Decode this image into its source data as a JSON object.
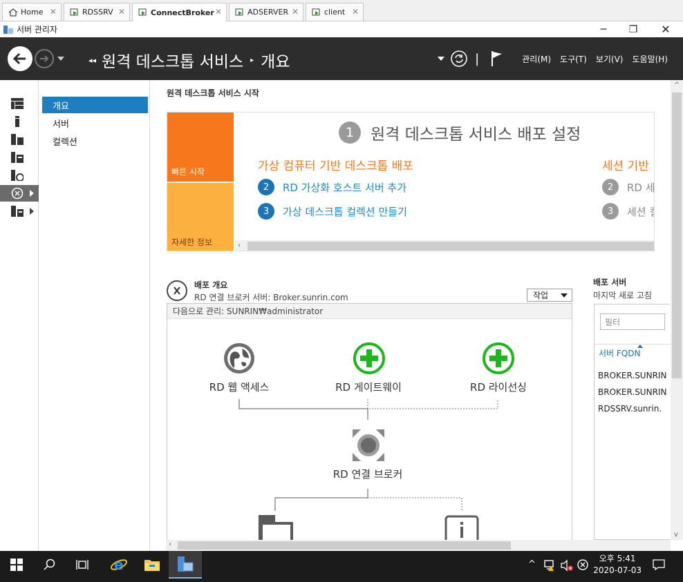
{
  "tabs": [
    {
      "label": "Home",
      "icon": "home-icon"
    },
    {
      "label": "RDSSRV",
      "icon": "vm-icon"
    },
    {
      "label": "ConnectBroker",
      "icon": "vm-icon",
      "active": true
    },
    {
      "label": "ADSERVER",
      "icon": "vm-icon"
    },
    {
      "label": "client",
      "icon": "vm-icon"
    }
  ],
  "window": {
    "title": "서버 관리자"
  },
  "header": {
    "breadcrumb_root": "원격 데스크톱 서비스",
    "breadcrumb_page": "개요",
    "menus": [
      "관리(M)",
      "도구(T)",
      "보기(V)",
      "도움말(H)"
    ]
  },
  "subnav": [
    "개요",
    "서버",
    "컬렉션"
  ],
  "main": {
    "section_title": "원격 데스크톱 서비스 시작",
    "quickstart": {
      "tile_quick": "빠른 시작",
      "tile_more": "자세한 정보",
      "step1_num": "1",
      "step1_label": "원격 데스크톱 서비스 배포 설정",
      "left_heading": "가상 컴퓨터 기반 데스크톱 배포",
      "left_steps": [
        {
          "num": "2",
          "label": "RD 가상화 호스트 서버 추가"
        },
        {
          "num": "3",
          "label": "가상 데스크톱 컬렉션 만들기"
        }
      ],
      "right_heading": "세션 기반",
      "right_steps": [
        {
          "num": "2",
          "label": "RD 세"
        },
        {
          "num": "3",
          "label": "세션 컬"
        }
      ]
    },
    "deployment": {
      "title": "배포 개요",
      "subtitle": "RD 연결 브로커 서버: Broker.sunrin.com",
      "task_button": "작업",
      "managed_as": "다음으로 관리: SUNRIN₩administrator",
      "roles": [
        "RD 웹 액세스",
        "RD 게이트웨이",
        "RD 라이선싱",
        "RD 연결 브로커"
      ]
    },
    "servers": {
      "title": "배포 서버",
      "subtitle": "마지막 새로 고침",
      "filter_placeholder": "필터",
      "column": "서버 FQDN",
      "rows": [
        "BROKER.SUNRIN",
        "BROKER.SUNRIN",
        "RDSSRV.sunrin."
      ]
    }
  },
  "taskbar": {
    "time": "오후 5:41",
    "date": "2020-07-03"
  },
  "colors": {
    "header": "#2d2d2d",
    "accent_blue": "#1e7fc0",
    "orange": "#f7781c",
    "amber": "#fbb040",
    "green": "#1fb51f"
  }
}
